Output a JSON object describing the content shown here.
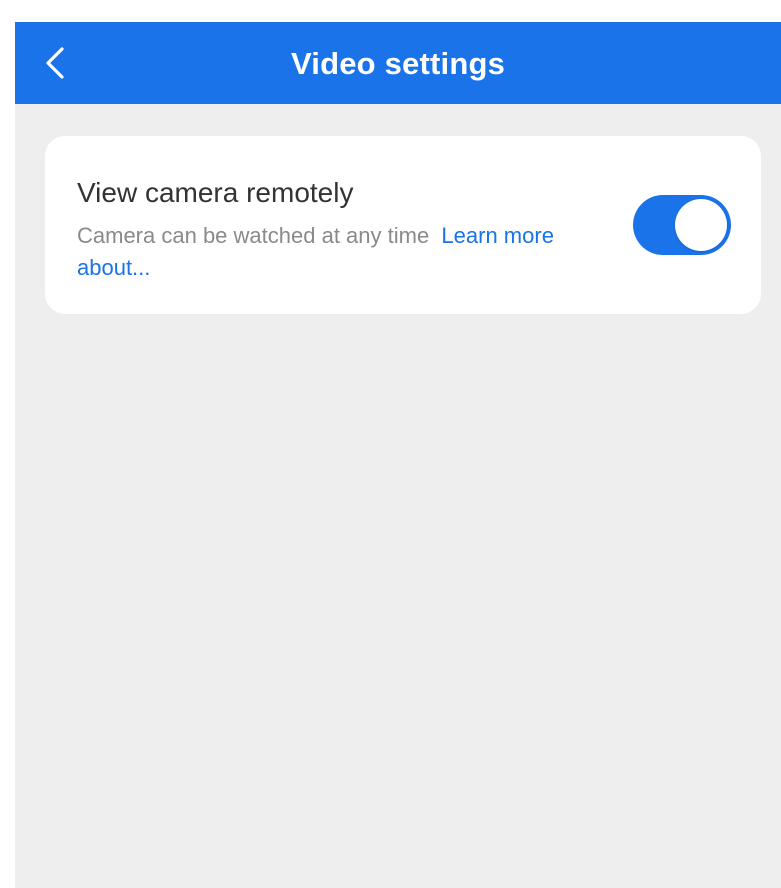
{
  "header": {
    "title": "Video settings",
    "back_icon": "chevron-left-icon"
  },
  "remote_view": {
    "title": "View camera remotely",
    "description": "Camera can be watched at any time",
    "link_text": "Learn more about...",
    "toggle_on": true
  },
  "colors": {
    "accent": "#1a73e8",
    "background": "#eeeeee",
    "card": "#ffffff",
    "title_text": "#333333",
    "secondary_text": "#8a8a8a"
  }
}
